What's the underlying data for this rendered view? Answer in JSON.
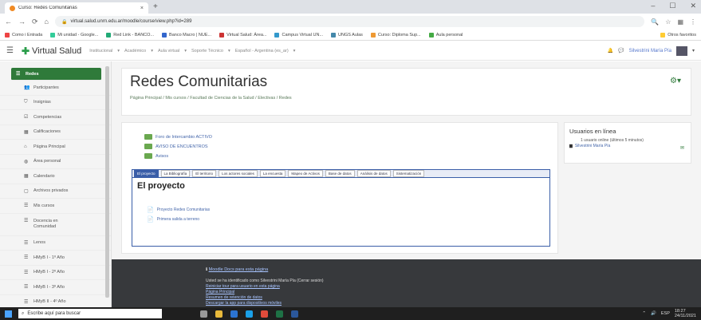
{
  "browser": {
    "tab_title": "Curso: Redes Comunitarias",
    "tab_close": "×",
    "new_tab": "+",
    "url": "virtual.salud.unrn.edu.ar/moodle/course/view.php?id=289",
    "bookmarks": [
      "Como i Entrada",
      "Mi unidad - Google...",
      "Red Link - BANCO...",
      "Banco Macro | NUE...",
      "Virtual Salud: Área...",
      "Campus Virtual UN...",
      "UNGS Aulas",
      "Curso: Diploma Sup...",
      "Aula personal",
      "Otros favoritos"
    ]
  },
  "moodle_nav": {
    "site_name": "Virtual Salud",
    "links": [
      "Institucional",
      "Académico",
      "Aula virtual",
      "Soporte Técnico",
      "Español - Argentina (es_ar)"
    ],
    "user_name": "Silvestrini María Pía"
  },
  "sidebar": {
    "items": [
      {
        "label": "Redes",
        "icon": "☰"
      },
      {
        "label": "Participantes",
        "icon": "👥"
      },
      {
        "label": "Insignias",
        "icon": "⛉"
      },
      {
        "label": "Competencias",
        "icon": "☑"
      },
      {
        "label": "Calificaciones",
        "icon": "▦"
      },
      {
        "label": "Página Principal",
        "icon": "⌂"
      },
      {
        "label": "Área personal",
        "icon": "◍"
      },
      {
        "label": "Calendario",
        "icon": "▦"
      },
      {
        "label": "Archivos privados",
        "icon": "▢"
      },
      {
        "label": "Mis cursos",
        "icon": "☰"
      },
      {
        "label": "Docencia en Comunidad",
        "icon": "☰"
      },
      {
        "label": "Lenos",
        "icon": "☰"
      },
      {
        "label": "HMyB I - 1º Año",
        "icon": "☰"
      },
      {
        "label": "HMyB I - 2º Año",
        "icon": "☰"
      },
      {
        "label": "HMyB I - 3º Año",
        "icon": "☰"
      },
      {
        "label": "HMyB II - 4º Año",
        "icon": "☰"
      }
    ]
  },
  "course": {
    "title": "Redes Comunitarias",
    "breadcrumb": "Página Principal / Mis cursos / Facultad de Ciencias de la Salud / Electivas / Redes",
    "activities": [
      "Foro de Intercambio ACTIVO",
      "AVISO DE ENCUENTROS",
      "Avisos"
    ],
    "tabs": [
      "El proyecto",
      "La Bibliografía",
      "El territorio",
      "Los actores sociales",
      "La encuesta",
      "Mapeo de Activos",
      "Base de datos",
      "Análisis de datos",
      "Sistematización"
    ],
    "section_title": "El proyecto",
    "resources": [
      "Proyecto Redes Comunitarias",
      "Primera salida a terreno"
    ]
  },
  "online": {
    "title": "Usuarios en línea",
    "subtitle": "1 usuario online (últimos 5 minutos)",
    "user": "Silvestrini María Pía"
  },
  "footer": {
    "docs": "Moodle Docs para esta página",
    "lines": [
      "Usted se ha identificado como Silvestrini María Pía (Cerrar sesión)",
      "Reiniciar tour para usuario en esta página",
      "Página Principal",
      "Resumen de retención de datos",
      "Descargar la app para dispositivos móviles"
    ]
  },
  "taskbar": {
    "search_placeholder": "Escribe aquí para buscar",
    "time": "18:27",
    "date": "24/11/2021",
    "lang": "ESP"
  }
}
